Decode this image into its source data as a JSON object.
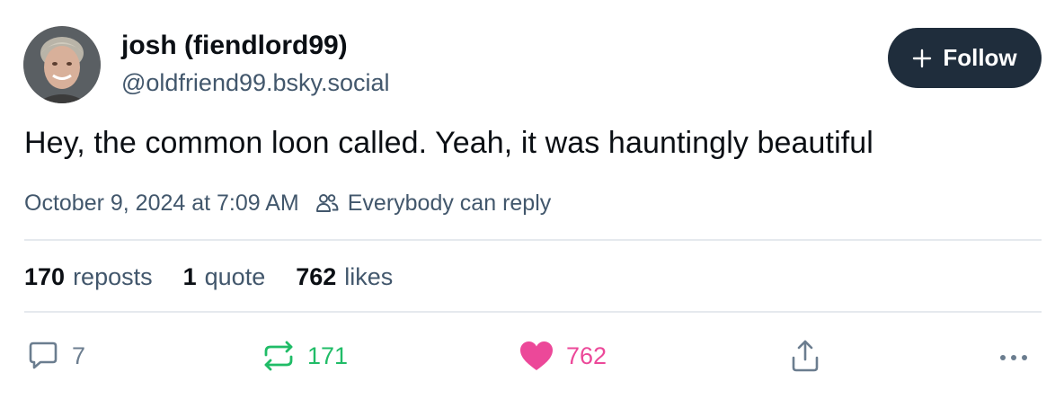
{
  "author": {
    "display_name": "josh (fiendlord99)",
    "handle": "@oldfriend99.bsky.social"
  },
  "follow_button": {
    "label": "Follow"
  },
  "post": {
    "text": "Hey, the common loon called. Yeah, it was hauntingly beautiful",
    "timestamp": "October 9, 2024 at 7:09 AM",
    "reply_setting": "Everybody can reply"
  },
  "stats": {
    "reposts_count": "170",
    "reposts_label": "reposts",
    "quotes_count": "1",
    "quotes_label": "quote",
    "likes_count": "762",
    "likes_label": "likes"
  },
  "actions": {
    "reply_count": "7",
    "repost_count": "171",
    "like_count": "762"
  },
  "colors": {
    "follow_bg": "#1f2d3c",
    "secondary_text": "#42576c",
    "repost_active": "#20bc67",
    "like_active": "#ec4899",
    "divider": "#e5e9ee"
  },
  "icons": {
    "plus": "plus-icon",
    "reply_setting": "people-icon",
    "reply": "speech-bubble-icon",
    "repost": "repost-icon",
    "like": "heart-icon",
    "share": "share-icon",
    "more": "more-dots-icon"
  }
}
